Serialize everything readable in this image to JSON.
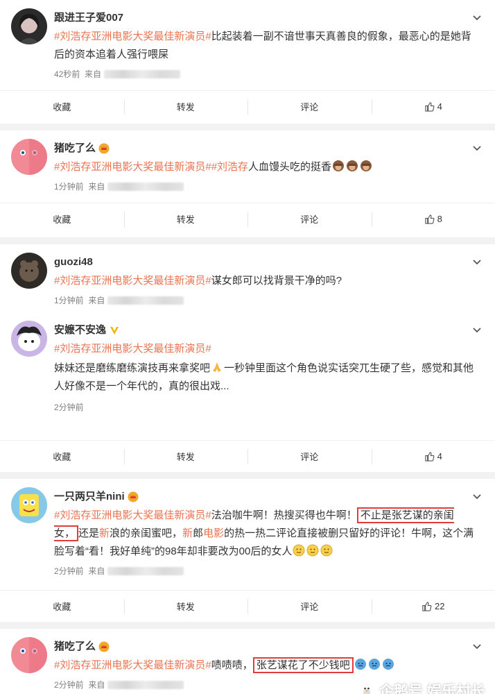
{
  "posts": [
    {
      "username": "跟进王子爱007",
      "hashtag": "#刘浩存亚洲电影大奖最佳新演员#",
      "text": "比起装着一副不谙世事天真善良的假象，最恶心的是她背后的资本追着人强行喂屎",
      "time": "42秒前",
      "source": "来自",
      "actions": {
        "collect": "收藏",
        "repost": "转发",
        "comment": "评论",
        "likes": "4"
      }
    },
    {
      "username": "猪吃了么",
      "hashtag": "#刘浩存亚洲电影大奖最佳新演员#",
      "hashtag2": "#刘浩存",
      "text": "人血馒头吃的挺香",
      "time": "1分钟前",
      "source": "来自",
      "actions": {
        "collect": "收藏",
        "repost": "转发",
        "comment": "评论",
        "likes": "8"
      }
    },
    {
      "username": "guozi48",
      "hashtag": "#刘浩存亚洲电影大奖最佳新演员#",
      "text": "谋女郎可以找背景干净的吗?",
      "time": "1分钟前",
      "source": "来自"
    },
    {
      "username": "安嬷不安逸",
      "hashtag": "#刘浩存亚洲电影大奖最佳新演员#",
      "text_a": "妹妹还是磨练磨练演技再来拿奖吧",
      "text_b": "一秒钟里面这个角色说实话突兀生硬了些，感觉和其他人好像不是一个年代的，真的很出戏...",
      "time": "2分钟前",
      "actions": {
        "collect": "收藏",
        "repost": "转发",
        "comment": "评论",
        "likes": "4"
      }
    },
    {
      "username": "一只两只羊nini",
      "hashtag": "#刘浩存亚洲电影大奖最佳新演员#",
      "text_a": "法治咖牛啊！热搜买得也牛啊！",
      "boxed": "不止是张艺谋的亲闺女，",
      "text_b": "还是",
      "hl_1": "新",
      "text_c": "浪的亲闺蜜吧，",
      "hl_2": "新",
      "text_d": "郎",
      "hl_3": "电影",
      "text_e": "的热一热二评论直接被删只留好的评论！牛啊，这个满脸写着“看！我好单纯”的98年却非要改为00后的女人",
      "time": "2分钟前",
      "source": "来自",
      "actions": {
        "collect": "收藏",
        "repost": "转发",
        "comment": "评论",
        "likes": "22"
      }
    },
    {
      "username": "猪吃了么",
      "hashtag": "#刘浩存亚洲电影大奖最佳新演员#",
      "text_a": "啧啧啧，",
      "boxed": "张艺谋花了不少钱吧",
      "time": "2分钟前",
      "source": "来自"
    }
  ],
  "watermark": {
    "brand": "企鹅号",
    "account": "娱乐村长"
  },
  "colors": {
    "hashtag": "#eb7350",
    "highlight_box": "#e23b3b",
    "meta": "#808080"
  }
}
